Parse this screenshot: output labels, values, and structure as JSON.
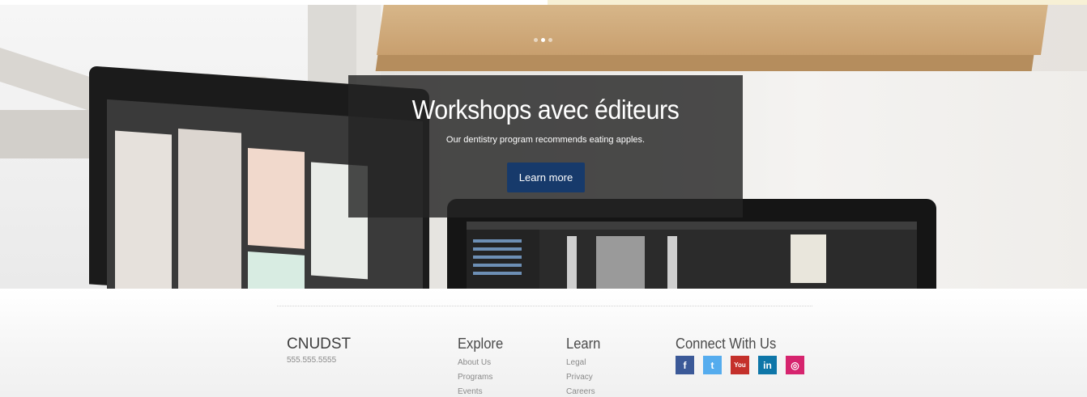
{
  "hero": {
    "slides": [
      {
        "active": false
      },
      {
        "active": true
      },
      {
        "active": false
      }
    ],
    "title": "Workshops avec éditeurs",
    "subtitle": "Our dentistry program recommends eating apples.",
    "button_label": "Learn more",
    "button_color": "#173a6b"
  },
  "footer": {
    "brand": "CNUDST",
    "phone": "555.555.5555",
    "explore": {
      "title": "Explore",
      "links": [
        "About Us",
        "Programs",
        "Events"
      ]
    },
    "learn": {
      "title": "Learn",
      "links": [
        "Legal",
        "Privacy",
        "Careers"
      ]
    },
    "connect": {
      "title": "Connect With Us",
      "social": [
        {
          "icon": "facebook-icon",
          "glyph": "f",
          "color": "#3b5998"
        },
        {
          "icon": "twitter-icon",
          "glyph": "t",
          "color": "#55acee"
        },
        {
          "icon": "youtube-icon",
          "glyph": "You",
          "color": "#c4302b"
        },
        {
          "icon": "linkedin-icon",
          "glyph": "in",
          "color": "#0e76a8"
        },
        {
          "icon": "instagram-icon",
          "glyph": "◎",
          "color": "#d6246e"
        }
      ]
    }
  }
}
